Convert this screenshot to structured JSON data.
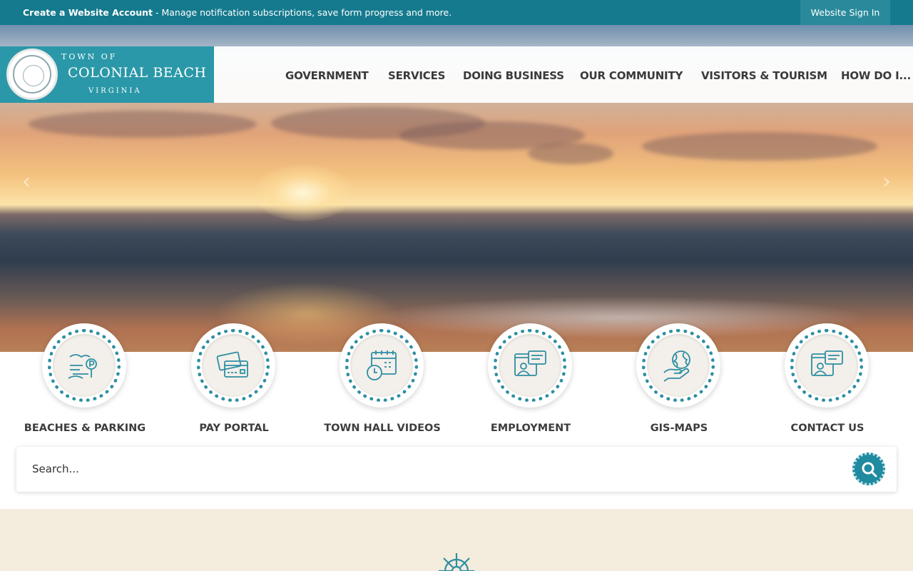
{
  "topbar": {
    "account_link": "Create a Website Account",
    "account_text": " - Manage notification subscriptions, save form progress and more.",
    "signin": "Website Sign In"
  },
  "logo": {
    "line1": "TOWN OF",
    "line2": "COLONIAL BEACH",
    "line3": "VIRGINIA"
  },
  "nav": [
    "GOVERNMENT",
    "SERVICES",
    "DOING BUSINESS",
    "OUR COMMUNITY",
    "VISITORS & TOURISM",
    "HOW DO I..."
  ],
  "hero": {
    "prev_icon": "chevron-left-icon",
    "next_icon": "chevron-right-icon"
  },
  "quick_links": [
    {
      "label": "BEACHES & PARKING",
      "icon": "beach-parking-icon"
    },
    {
      "label": "PAY PORTAL",
      "icon": "credit-card-icon"
    },
    {
      "label": "TOWN HALL VIDEOS",
      "icon": "calendar-clock-icon"
    },
    {
      "label": "EMPLOYMENT",
      "icon": "person-chat-icon"
    },
    {
      "label": "GIS-MAPS",
      "icon": "hand-globe-icon"
    },
    {
      "label": "CONTACT US",
      "icon": "contact-chat-icon"
    }
  ],
  "search": {
    "placeholder": "Search...",
    "icon": "search-icon"
  },
  "band": {
    "icon": "ship-wheel-icon"
  },
  "colors": {
    "topbar": "#157a8e",
    "accent": "#2a98a8",
    "band": "#f4ecdd"
  }
}
